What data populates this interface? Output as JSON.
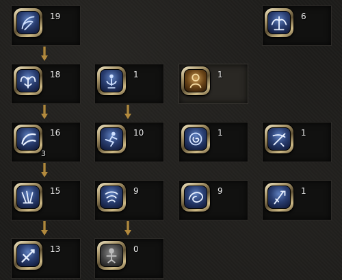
{
  "skill_tree": {
    "nodes": [
      {
        "id": "r1c1",
        "icon": "swirl-rune-icon",
        "count": "19",
        "style": "blue"
      },
      {
        "id": "r1c4",
        "icon": "wings-emblem-icon",
        "count": "6",
        "style": "blue"
      },
      {
        "id": "r2c1",
        "icon": "feather-wings-icon",
        "count": "18",
        "style": "blue"
      },
      {
        "id": "r2c2",
        "icon": "praying-figure-icon",
        "count": "1",
        "style": "blue"
      },
      {
        "id": "r2c3",
        "icon": "hooded-figure-icon",
        "count": "1",
        "style": "gold"
      },
      {
        "id": "r3c1",
        "icon": "crescent-wave-icon",
        "count": "16",
        "sub": "3",
        "style": "blue"
      },
      {
        "id": "r3c2",
        "icon": "running-figure-icon",
        "count": "10",
        "style": "blue"
      },
      {
        "id": "r3c3",
        "icon": "spiral-orb-icon",
        "count": "1",
        "style": "blue"
      },
      {
        "id": "r3c4",
        "icon": "sword-slash-icon",
        "count": "1",
        "style": "blue"
      },
      {
        "id": "r4c1",
        "icon": "triple-claw-icon",
        "count": "15",
        "style": "blue"
      },
      {
        "id": "r4c2",
        "icon": "whirlwind-icon",
        "count": "9",
        "style": "blue"
      },
      {
        "id": "r4c3",
        "icon": "vortex-icon",
        "count": "9",
        "style": "blue"
      },
      {
        "id": "r4c4",
        "icon": "blade-strike-icon",
        "count": "1",
        "style": "blue"
      },
      {
        "id": "r5c1",
        "icon": "spear-icon",
        "count": "13",
        "style": "blue"
      },
      {
        "id": "r5c2",
        "icon": "locked-figure-icon",
        "count": "0",
        "style": "gray"
      }
    ]
  },
  "colors": {
    "background": "#1d1c1a",
    "slot": "#111110",
    "arrow": "#b38a3d",
    "frame": "#cdb986",
    "icon_blue": "#2a3f72",
    "text": "#ededed"
  }
}
